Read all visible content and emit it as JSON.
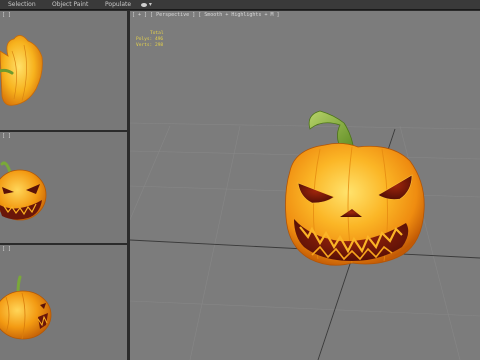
{
  "menu": {
    "items": [
      "Selection",
      "Object Paint",
      "Populate"
    ],
    "show_menu_label": "▾"
  },
  "viewports": {
    "top_label": "[ ]",
    "mid_label": "[ ]",
    "bot_label": "[ ]",
    "main_label": "[ + ] [ Perspective ] [ Smooth + Highlights + M ]"
  },
  "stats": {
    "title": "Total",
    "polys_label": "Polys:",
    "polys_value": "496",
    "verts_label": "Verts:",
    "verts_value": "298"
  },
  "colors": {
    "viewport_bg": "#787878",
    "pumpkin_orange": "#f39a12",
    "stem_green": "#7aa83a",
    "stats_yellow": "#e6d34a"
  }
}
